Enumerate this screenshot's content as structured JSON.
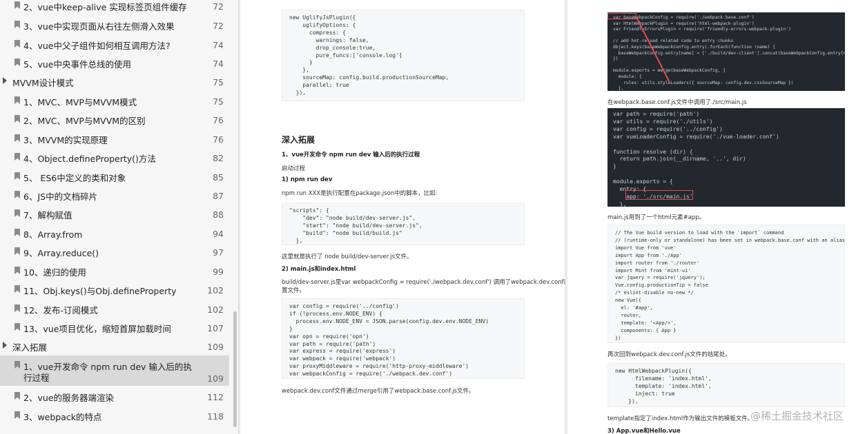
{
  "toc": [
    {
      "label": "2、vue中keep-alive 实现标签页组件缓存",
      "page": "72",
      "type": "item"
    },
    {
      "label": "3、vue中实现页面从右往左侧滑入效果",
      "page": "72",
      "type": "item"
    },
    {
      "label": "4、vue中父子组件如何相互调用方法?",
      "page": "74",
      "type": "item"
    },
    {
      "label": "5、vue中央事件总线的使用",
      "page": "74",
      "type": "item"
    },
    {
      "label": "MVVM设计模式",
      "page": "75",
      "type": "section"
    },
    {
      "label": "1、MVC、MVP与MVVM模式",
      "page": "75",
      "type": "item"
    },
    {
      "label": "2、MVC、MVP与MVVM的区别",
      "page": "76",
      "type": "item"
    },
    {
      "label": "3、MVVM的实现原理",
      "page": "76",
      "type": "item"
    },
    {
      "label": "4、Object.defineProperty()方法",
      "page": "82",
      "type": "item"
    },
    {
      "label": "5、 ES6中定义的类和对象",
      "page": "85",
      "type": "item"
    },
    {
      "label": "6、JS中的文档碎片",
      "page": "87",
      "type": "item"
    },
    {
      "label": "7、解构赋值",
      "page": "88",
      "type": "item"
    },
    {
      "label": "8、Array.from",
      "page": "94",
      "type": "item"
    },
    {
      "label": "9、Array.reduce()",
      "page": "97",
      "type": "item"
    },
    {
      "label": "10、递归的使用",
      "page": "99",
      "type": "item"
    },
    {
      "label": "11、Obj.keys()与Obj.defineProperty",
      "page": "102",
      "type": "item"
    },
    {
      "label": "12、发布-订阅模式",
      "page": "102",
      "type": "item"
    },
    {
      "label": "13、vue项目优化，缩短首屏加载时间",
      "page": "107",
      "type": "item"
    },
    {
      "label": "深入拓展",
      "page": "109",
      "type": "section"
    },
    {
      "label": "1、vue开发命令 npm run dev 输入后的执",
      "label2": "行过程",
      "page": "109",
      "type": "item",
      "active": true
    },
    {
      "label": "2、vue的服务器端渲染",
      "page": "112",
      "type": "item"
    },
    {
      "label": "3、webpack的特点",
      "page": "118",
      "type": "item"
    }
  ],
  "page1": {
    "code1": [
      "new UglifyJsPlugin({",
      "    uglifyOptions: {",
      "      compress: {",
      "        warnings: false,",
      "        drop_console:true,",
      "        pure_funcs:['console.log']",
      "      }",
      "    },",
      "    sourceMap: config.build.productionSourceMap,",
      "    parallel: true",
      "  }),"
    ],
    "section_title": "深入拓展",
    "sub1": "1、vue开发命令 npm run dev 输入后的执行过程",
    "p_start": "启动过程",
    "sub_npm": "1)  npm run dev",
    "p_npm": "npm run XXX是执行配置在package.json中的脚本，比如:",
    "code2": [
      "\"scripts\": {",
      "    \"dev\": \"node build/dev-server.js\",",
      "    \"start\": \"node build/dev-server.js\",",
      "    \"build\": \"node build/build.js\"",
      "  },"
    ],
    "p_exec": "这里就是执行了 node build/dev-server.js文件。",
    "sub_main": "2)  main.js和index.html",
    "p_devserver": "build/dev-server.js里var webpackConfig = require('./webpack.dev.conf') 调用了webpack.dev.conf配",
    "p_devserver2": "置文件。",
    "code3": [
      "var config = require('../config')",
      "if (!process.env.NODE_ENV) {",
      "  process.env.NODE_ENV = JSON.parse(config.dev.env.NODE_ENV)",
      "}",
      "var opn = require('opn')",
      "var path = require('path')",
      "var express = require('express')",
      "var webpack = require('webpack')",
      "var proxyMiddleware = require('http-proxy-middleware')",
      "var webpackConfig = require('./webpack.dev.conf')"
    ],
    "p_merge": "webpack.dev.conf文件通过merge引用了webpack.base.conf.js文件。"
  },
  "page2": {
    "code1": [
      "var baseWebpackConfig = require('./webpack.base.conf')",
      "var HtmlWebpackPlugin = require('html-webpack-plugin')",
      "var FriendlyErrorsPlugin = require('friendly-errors-webpack-plugin')",
      "",
      "// add hot-reload related code to entry chunks",
      "Object.keys(baseWebpackConfig.entry).forEach(function (name) {",
      "  baseWebpackConfig.entry[name] = ['./build/dev-client'].concat(baseWebpackConfig.entry[name])",
      "})",
      "",
      "module.exports = merge(baseWebpackConfig, {",
      "  module: {",
      "    rules: utils.styleLoaders({ sourceMap: config.dev.cssSourceMap })",
      "  },"
    ],
    "p_base": "在webpack.base.conf.js文件中调用了./src/main.js",
    "code2": [
      "var path = require('path')",
      "var utils = require('./utils')",
      "var config = require('../config')",
      "var vueLoaderConfig = require('./vue-loader.conf')",
      "",
      "function resolve (dir) {",
      "  return path.join(__dirname, '..', dir)",
      "}",
      "",
      "module.exports = {",
      "  entry: {",
      "    app: './src/main.js'",
      "  },"
    ],
    "p_mainjs": "main.js用到了一个html元素#app。",
    "code3": [
      "// The Vue build version to load with the `import` command",
      "// (runtime-only or standalone) has been set in webpack.base.conf with an alias.",
      "import Vue from 'vue'",
      "import App from './App'",
      "import router from './router'",
      "import Mint from 'mint-ui'",
      "var jquery = require('jquery');",
      "Vue.config.productionTip = false",
      "/* eslint-disable no-new */",
      "new Vue({",
      "  el: '#app',",
      "  router,",
      "  template: '<App/>',",
      "  components: { App }",
      "})"
    ],
    "p_back": "再次回到webpack.dev.conf.js文件的结尾处。",
    "code4": [
      "new HtmlWebpackPlugin({",
      "      filename: 'index.html',",
      "      template: 'index.html',",
      "      inject: true",
      "    }),"
    ],
    "p_template": "template指定了index.html作为输出文件的模板文件。",
    "sub_app": "3)  App.vue和Hello.vue"
  },
  "watermark": "@稀土掘金技术社区",
  "colors": {
    "accent_red": "#e05050",
    "dark_code_bg": "#23272e"
  }
}
